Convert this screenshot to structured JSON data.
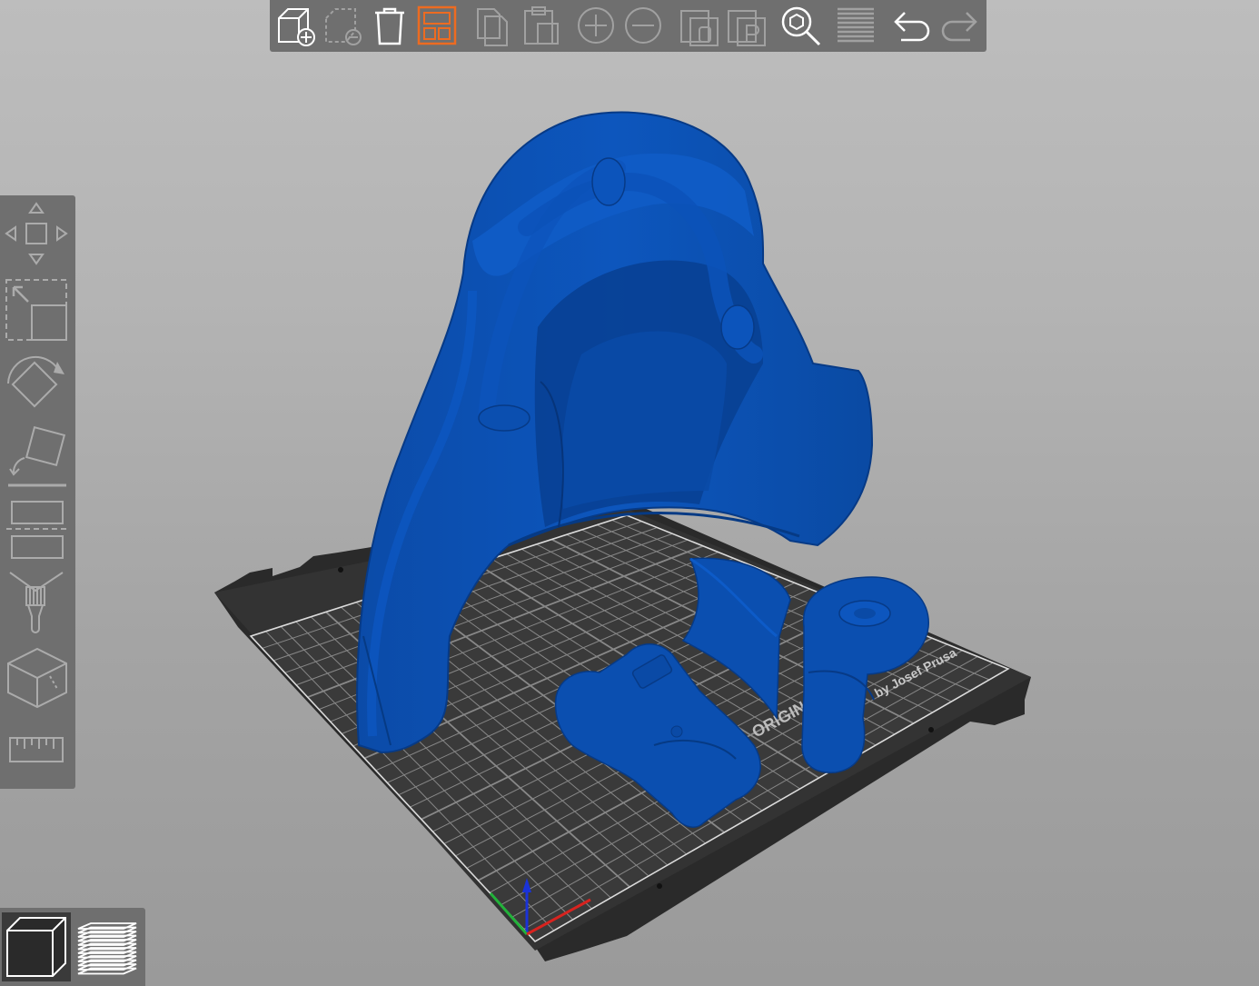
{
  "viewport": {
    "bed_label_brand": "ORIGINAL",
    "bed_label_byline": "by Josef Prusa",
    "model_color": "#0a4fae",
    "bed_color": "#2e2e2e",
    "grid_color": "#cfcfcf"
  },
  "top_toolbar": {
    "accent_color": "#ed6b21",
    "buttons": [
      {
        "name": "add-button",
        "icon": "cube-plus-icon",
        "enabled": true,
        "active": false
      },
      {
        "name": "delete-button",
        "icon": "cube-dashed-minus-icon",
        "enabled": false,
        "active": false
      },
      {
        "name": "delete-all-button",
        "icon": "trash-icon",
        "enabled": true,
        "active": false
      },
      {
        "name": "arrange-button",
        "icon": "arrange-icon",
        "enabled": true,
        "active": true
      },
      {
        "name": "copy-button",
        "icon": "copy-icon",
        "enabled": false,
        "active": false
      },
      {
        "name": "paste-button",
        "icon": "paste-icon",
        "enabled": false,
        "active": false
      },
      {
        "name": "add-instance-button",
        "icon": "circle-plus-icon",
        "enabled": false,
        "active": false
      },
      {
        "name": "remove-instance-button",
        "icon": "circle-minus-icon",
        "enabled": false,
        "active": false
      },
      {
        "name": "split-objects-button",
        "icon": "split-objects-icon",
        "enabled": false,
        "active": false
      },
      {
        "name": "split-parts-button",
        "icon": "split-parts-icon",
        "enabled": false,
        "active": false
      },
      {
        "name": "search-button",
        "icon": "search-icon",
        "enabled": true,
        "active": false
      },
      {
        "name": "layers-editing-button",
        "icon": "layers-icon",
        "enabled": false,
        "active": false
      },
      {
        "name": "undo-button",
        "icon": "undo-icon",
        "enabled": true,
        "active": false
      },
      {
        "name": "redo-button",
        "icon": "redo-icon",
        "enabled": false,
        "active": false
      }
    ]
  },
  "left_toolbar": {
    "tools": [
      {
        "name": "move-tool",
        "icon": "move-icon"
      },
      {
        "name": "scale-tool",
        "icon": "scale-icon"
      },
      {
        "name": "rotate-tool",
        "icon": "rotate-icon"
      },
      {
        "name": "place-on-face-tool",
        "icon": "place-on-face-icon"
      },
      {
        "name": "cut-tool",
        "icon": "cut-icon"
      },
      {
        "name": "paint-supports-tool",
        "icon": "paint-brush-icon"
      },
      {
        "name": "seam-painting-tool",
        "icon": "seam-cube-icon"
      },
      {
        "name": "measure-tool",
        "icon": "ruler-icon"
      }
    ]
  },
  "view_switcher": {
    "items": [
      {
        "name": "3d-view-button",
        "icon": "3d-cube-icon",
        "active": true
      },
      {
        "name": "preview-button",
        "icon": "layers-preview-icon",
        "active": false
      }
    ]
  }
}
